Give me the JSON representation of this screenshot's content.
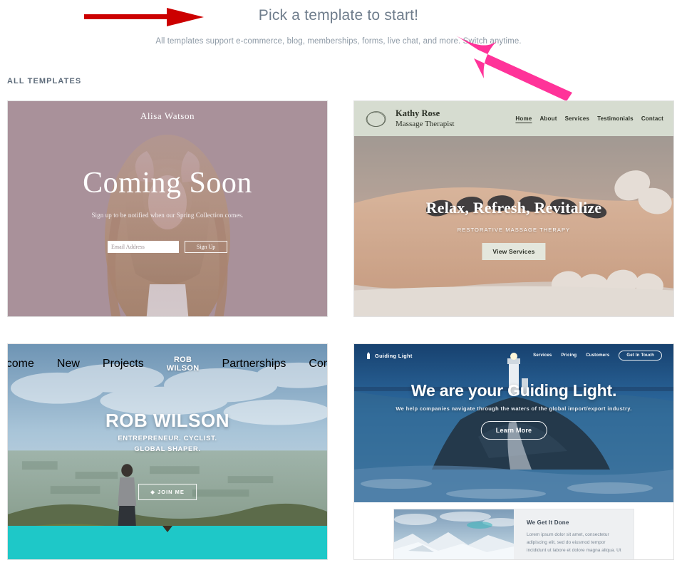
{
  "header": {
    "title": "Pick a template to start!",
    "subtitle": "All templates support e-commerce, blog, memberships, forms, live chat, and more. Switch anytime.",
    "section_label": "ALL TEMPLATES"
  },
  "annotations": {
    "red_arrow": {
      "name": "red-arrow-pointing-right",
      "color": "#CC0000"
    },
    "pink_arrow": {
      "name": "pink-arrow-pointing-upleft",
      "color": "#FF3399"
    }
  },
  "templates": [
    {
      "id": "alisa-watson",
      "brand": "Alisa Watson",
      "headline": "Coming Soon",
      "subtext": "Sign up to be notified when our Spring Collection comes.",
      "email_placeholder": "Email Address",
      "signup_label": "Sign Up",
      "bg_color": "#a9919a"
    },
    {
      "id": "kathy-rose",
      "brand_name": "Kathy Rose",
      "brand_tagline": "Massage Therapist",
      "logo_icon": "ellipse-sketch-icon",
      "nav": [
        {
          "label": "Home",
          "active": true
        },
        {
          "label": "About",
          "active": false
        },
        {
          "label": "Services",
          "active": false
        },
        {
          "label": "Testimonials",
          "active": false
        },
        {
          "label": "Contact",
          "active": false
        }
      ],
      "headline": "Relax, Refresh, Revitalize",
      "subtext": "RESTORATIVE MASSAGE THERAPY",
      "button_label": "View Services",
      "nav_bg": "#D6DCD0"
    },
    {
      "id": "rob-wilson",
      "logo_line1": "ROB",
      "logo_line2": "WILSON",
      "nav_left": [
        {
          "label": "Welcome"
        },
        {
          "label": "New"
        },
        {
          "label": "Projects"
        }
      ],
      "nav_right": [
        {
          "label": "Partnerships"
        },
        {
          "label": "Contact"
        }
      ],
      "headline": "ROB WILSON",
      "subtext_line1": "ENTREPRENEUR. CYCLIST.",
      "subtext_line2": "GLOBAL SHAPER.",
      "button_label": "JOIN ME",
      "band_color": "#1EC8C8"
    },
    {
      "id": "guiding-light",
      "logo_text": "Guiding Light",
      "logo_icon": "lighthouse-icon",
      "nav": [
        {
          "label": "Services"
        },
        {
          "label": "Pricing"
        },
        {
          "label": "Customers"
        }
      ],
      "cta_label": "Get In Touch",
      "headline": "We are your Guiding Light.",
      "subtext": "We help companies navigate through the waters of the global import/export industry.",
      "button_label": "Learn More",
      "panel_heading": "We Get It Done",
      "panel_body": "Lorem ipsum dolor sit amet, consectetur adipiscing elit, sed do eiusmod tempor incididunt ut labore et dolore magna aliqua. Ut"
    }
  ]
}
